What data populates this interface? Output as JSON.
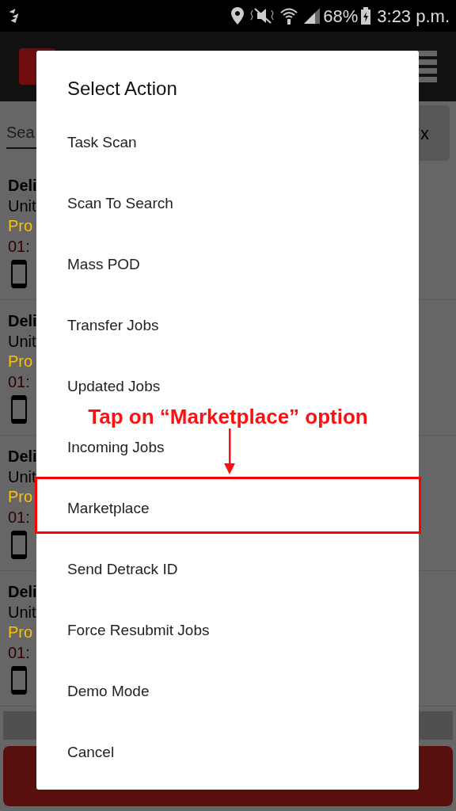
{
  "status_bar": {
    "battery": "68%",
    "time": "3:23 p.m."
  },
  "app": {
    "search": {
      "placeholder": "Sea"
    },
    "clear_button": "x",
    "jobs": [
      {
        "title": "Deli",
        "line_2": "Unit",
        "status": "Pro",
        "time": "01:"
      },
      {
        "title": "Deli",
        "line_2": "Unit",
        "status": "Pro",
        "time": "01:"
      },
      {
        "title": "Deli",
        "line_2": "Unit",
        "status": "Pro",
        "time": "01:"
      },
      {
        "title": "Deli",
        "line_2": "Unit",
        "status": "Pro",
        "time": "01:"
      }
    ]
  },
  "dialog": {
    "title": "Select Action",
    "items": [
      {
        "label": "Task Scan",
        "highlighted": false
      },
      {
        "label": "Scan To Search",
        "highlighted": false
      },
      {
        "label": "Mass POD",
        "highlighted": false
      },
      {
        "label": "Transfer Jobs",
        "highlighted": false
      },
      {
        "label": "Updated Jobs",
        "highlighted": false
      },
      {
        "label": "Incoming Jobs",
        "highlighted": false
      },
      {
        "label": "Marketplace",
        "highlighted": true
      },
      {
        "label": "Send Detrack ID",
        "highlighted": false
      },
      {
        "label": "Force Resubmit Jobs",
        "highlighted": false
      },
      {
        "label": "Demo Mode",
        "highlighted": false
      },
      {
        "label": "Cancel",
        "highlighted": false
      }
    ]
  },
  "annotation": {
    "text": "Tap on “Marketplace” option"
  }
}
